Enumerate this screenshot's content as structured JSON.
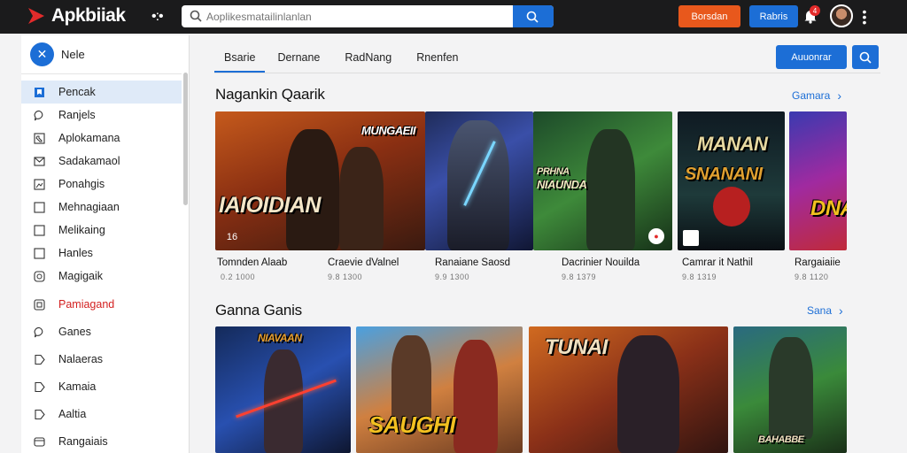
{
  "topbar": {
    "brand": "Apkbiiak",
    "search_placeholder": "Aoplikesmatailinlanlan",
    "btn_orange": "Borsdan",
    "btn_blue": "Rabris",
    "badge": "4"
  },
  "sidebar": {
    "title": "Nele",
    "items": [
      {
        "label": "Pencak",
        "icon": "bookmark-icon"
      },
      {
        "label": "Ranjels",
        "icon": "chat-bubble-icon"
      },
      {
        "label": "Aplokamana",
        "icon": "phone-icon"
      },
      {
        "label": "Sadakamaol",
        "icon": "mail-icon"
      },
      {
        "label": "Ponahgis",
        "icon": "image-icon"
      },
      {
        "label": "Mehnagiaan",
        "icon": "square-icon"
      },
      {
        "label": "Melikaing",
        "icon": "square-icon"
      },
      {
        "label": "Hanles",
        "icon": "square-icon"
      },
      {
        "label": "Magigaik",
        "icon": "refresh-icon"
      },
      {
        "label": "Pamiagand",
        "icon": "calendar-icon"
      },
      {
        "label": "Ganes",
        "icon": "chat-bubble-icon"
      },
      {
        "label": "Nalaeras",
        "icon": "tag-icon"
      },
      {
        "label": "Kamaia",
        "icon": "tag-icon"
      },
      {
        "label": "Aaltia",
        "icon": "tag-icon"
      },
      {
        "label": "Rangaiais",
        "icon": "folder-icon"
      }
    ]
  },
  "main": {
    "tabs": [
      "Bsarie",
      "Dernane",
      "RadNang",
      "Rnenfen"
    ],
    "action_button": "Auuonrar",
    "section1": {
      "title": "Nagankin Qaarik",
      "link": "Gamara"
    },
    "section2": {
      "title": "Ganna Ganis",
      "link": "Sana"
    },
    "featured": [
      {
        "name": "Tomnden Alaab",
        "meta": "0.2 1000",
        "art": "IAIOIDIAN",
        "art2": "MUNGAEII",
        "badge": "16"
      },
      {
        "name": "Craevie dValnel",
        "meta": "9.8 1300"
      },
      {
        "name": "Ranaiane Saosd",
        "meta": "9.9 1300"
      },
      {
        "name": "Dacrinier Nouilda",
        "meta": "9.8 1379",
        "art": "PRHNA",
        "art2": "NIAUNDA"
      },
      {
        "name": "Camrar it Nathil",
        "meta": "9.8 1319",
        "art": "MANAN",
        "art2": "SNANANI"
      },
      {
        "name": "Rargaiaiie",
        "meta": "9.8 1120",
        "art": "DNA"
      }
    ],
    "games": [
      {
        "art": "NIAVAAN"
      },
      {
        "art": "SAUGHI"
      },
      {
        "art": "TUNAI"
      },
      {
        "art": "BAHABBE"
      }
    ]
  },
  "colors": {
    "accent": "#1c6ed6",
    "orange": "#e8581c",
    "topbar": "#1b1b1c",
    "red_text": "#d32020"
  }
}
